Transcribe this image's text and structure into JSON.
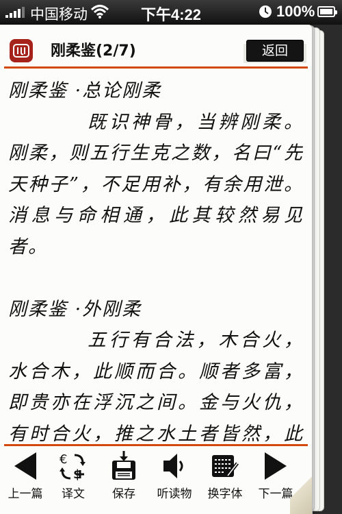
{
  "status_bar": {
    "carrier": "中国移动",
    "time": "下午4:22",
    "battery": "100%"
  },
  "header": {
    "title": "刚柔鉴(2/7)",
    "back_label": "返回",
    "accent_color": "#d14a0c",
    "seal_color": "#a5231a"
  },
  "content": {
    "sections": [
      {
        "heading": "刚柔鉴 ·总论刚柔",
        "text": "既识神骨，当辨刚柔。刚柔，则五行生克之数，名曰“先天种子”，不足用补，有余用泄。消息与命相通，此其较然易见者。"
      },
      {
        "heading": "刚柔鉴 ·外刚柔",
        "text": "五行有合法，木合火，水合木，此顺而合。顺者多富，即贵亦在浮沉之间。金与火仇，有时合火，推之水土者皆然，此逆而合者，其贵非常。然所谓逆合者，金形带火"
      }
    ]
  },
  "toolbar": {
    "prev_label": "上一篇",
    "translate_label": "译文",
    "save_label": "保存",
    "listen_label": "听读物",
    "font_label": "换字体",
    "next_label": "下一篇"
  },
  "icons": [
    "wifi-icon",
    "lock-rotation-icon",
    "battery-icon",
    "seal-logo-icon",
    "prev-arrow-icon",
    "translate-icon",
    "save-disk-icon",
    "speaker-icon",
    "font-keyboard-icon",
    "next-arrow-icon"
  ]
}
